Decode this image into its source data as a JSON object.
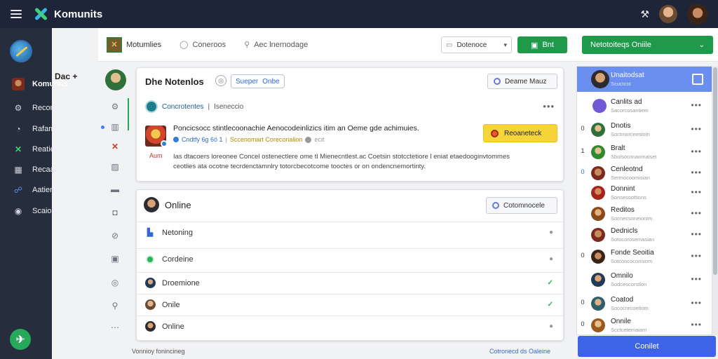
{
  "topbar": {
    "brand": "Komunits",
    "icons": [
      "menu-icon",
      "wrench-icon"
    ]
  },
  "sidebar": {
    "workspace_label": "Dac +",
    "items": [
      {
        "label": "Komunits",
        "icon": "community-icon"
      },
      {
        "label": "Recommis",
        "icon": "gear-icon"
      },
      {
        "label": "Rafamiley",
        "icon": "clock-icon"
      },
      {
        "label": "Reatie",
        "icon": "x-icon"
      },
      {
        "label": "Recaamad",
        "icon": "grid-icon"
      },
      {
        "label": "Aatiems",
        "icon": "users-icon"
      },
      {
        "label": "Scaio",
        "icon": "circle-icon"
      }
    ],
    "fab_icon": "plane-icon"
  },
  "content_header": {
    "tab1": "Motumlies",
    "tab2": "Coneroos",
    "tab3": "Aec lnernodage",
    "select_value": "Dotenoce",
    "green_button": "Bnt"
  },
  "card1": {
    "title": "Dhe Notenlos",
    "chip_label": "Sueper",
    "chip_label2": "Onbe",
    "button_label": "Deame Mauz",
    "sub_a": "Concrotentes",
    "sub_sep": "|",
    "sub_b": "Iseneccio",
    "headline": "Poncicsocc stintlecoonachie Aenocodeinlizics itim an Oeme gde achimuies.",
    "meta1": "Cndtfy 6g 6ö 1",
    "meta_sep": "|",
    "meta3": "Sccenomart Corecorialion",
    "meta4": "ecit",
    "thumb_label": "Aum",
    "body": "Ias dtacoers loreonee Concel ostenectlere ome tl Mienecntlest.ac Coetsin stotcctetiore l eniat etaedooginvtommes ceotlies ata ocotne tecrdenctamnlry totorcbecotcome tooctes or on ondencnemortinty."
  },
  "yellow_button": "Reoaneteck",
  "card2": {
    "title": "Online",
    "button_label": "Cotomnocele",
    "rows": [
      {
        "label": "Netoning",
        "status": "dot"
      },
      {
        "label": "Cordeine",
        "status": "dot"
      },
      {
        "label": "Droemione",
        "status": "check"
      },
      {
        "label": "Onile",
        "status": "check"
      },
      {
        "label": "Online",
        "status": "dot"
      }
    ]
  },
  "footer": {
    "left": "Vonnioy fonincineg",
    "right": "Cotronecd ds Oaleine"
  },
  "right_panel": {
    "dropdown": "Netotoiteqs Oniile",
    "items": [
      {
        "num": "",
        "name": "Unaitodsat",
        "sub": "Scuctcot",
        "selected": true
      },
      {
        "num": "",
        "name": "Canlits  ad",
        "sub": "Sacorcosantiem",
        "selected": false
      },
      {
        "num": "0",
        "name": "Dnotis",
        "sub": "Soctmorceesiom",
        "selected": false
      },
      {
        "num": "1",
        "name": "Bralt",
        "sub": "Sbolsocnnaomaiset",
        "selected": false
      },
      {
        "num": "0",
        "name": "Cenleotnd",
        "sub": "Sermocoomisian",
        "selected": false
      },
      {
        "num": "",
        "name": "Donnint",
        "sub": "Sonsessottions",
        "selected": false
      },
      {
        "num": "",
        "name": "Reditos",
        "sub": "Socnecsoneionim",
        "selected": false
      },
      {
        "num": "",
        "name": "Dednicls",
        "sub": "Sotocorosemasian",
        "selected": false
      },
      {
        "num": "0",
        "name": "Fonde Seoitia",
        "sub": "Sotconcoconsiom",
        "selected": false
      },
      {
        "num": "",
        "name": "Omnilo",
        "sub": "Sodcescorstlon",
        "selected": false
      },
      {
        "num": "0",
        "name": "Coatod",
        "sub": "Sococrecoetiom",
        "selected": false
      },
      {
        "num": "0",
        "name": "Onnile",
        "sub": "Scctcetemaiam",
        "selected": false
      }
    ],
    "contact_button": "Conilet"
  },
  "colors": {
    "topbar": "#1e2538",
    "sidebar": "#262d3d",
    "green": "#1f9a4b",
    "blue_button": "#3d63e6",
    "selected_row": "#6b8ff0",
    "yellow": "#f6d53a"
  }
}
